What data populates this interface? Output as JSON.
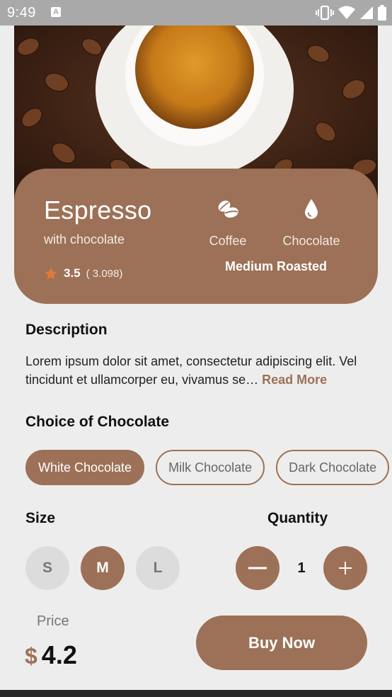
{
  "status_bar": {
    "time": "9:49",
    "app_badge": "A"
  },
  "product": {
    "name": "Espresso",
    "subtitle": "with chocolate",
    "rating": "3.5",
    "rating_count": "( 3.098)",
    "features": [
      {
        "icon": "coffee-beans-icon",
        "label": "Coffee"
      },
      {
        "icon": "drop-icon",
        "label": "Chocolate"
      }
    ],
    "roast": "Medium Roasted"
  },
  "description": {
    "heading": "Description",
    "text": "Lorem ipsum dolor sit amet, consectetur adipiscing elit. Vel tincidunt et ullamcorper eu, vivamus se… ",
    "read_more": "Read More"
  },
  "chocolate": {
    "heading": "Choice of Chocolate",
    "options": [
      "White Chocolate",
      "Milk Chocolate",
      "Dark Chocolate"
    ],
    "selected": "White Chocolate"
  },
  "size": {
    "heading": "Size",
    "options": [
      "S",
      "M",
      "L"
    ],
    "selected": "M"
  },
  "quantity": {
    "heading": "Quantity",
    "value": "1",
    "minus": "—",
    "plus": "+"
  },
  "price": {
    "label": "Price",
    "currency": "$",
    "amount": "4.2"
  },
  "buy_button": "Buy Now",
  "colors": {
    "accent": "#9c7157",
    "background": "#eeeded",
    "status_bar": "#a9a9a9"
  }
}
